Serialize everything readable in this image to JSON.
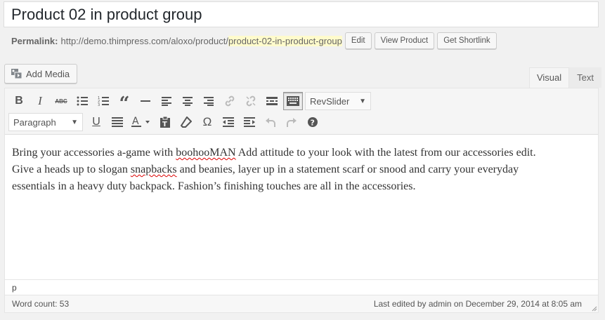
{
  "title": "Product 02 in product group",
  "permalink": {
    "label": "Permalink:",
    "base_url": "http://demo.thimpress.com/aloxo/product/",
    "slug": "product-02-in-product-group",
    "edit_label": "Edit",
    "view_label": "View Product",
    "shortlink_label": "Get Shortlink"
  },
  "add_media_label": "Add Media",
  "tabs": [
    {
      "label": "Visual",
      "active": true
    },
    {
      "label": "Text",
      "active": false
    }
  ],
  "toolbar": {
    "row1": [
      "bold",
      "italic",
      "strikethrough",
      "bullet-list",
      "numbered-list",
      "blockquote",
      "horizontal-line",
      "align-left",
      "align-center",
      "align-right",
      "insert-link",
      "remove-link",
      "read-more",
      "toolbar-toggle"
    ],
    "revslider_label": "RevSlider",
    "format_label": "Paragraph",
    "row2": [
      "underline",
      "justify",
      "text-color",
      "paste-as-text",
      "clear-formatting",
      "special-character",
      "outdent",
      "indent",
      "undo",
      "redo",
      "help"
    ]
  },
  "content": {
    "line1_before": "Bring your accessories a-game with ",
    "line1_spell": "boohooMAN",
    "line1_after": " Add attitude to your look with the latest from our accessories edit.",
    "line2_before": "Give a heads up to slogan ",
    "line2_spell": "snapbacks",
    "line2_after": " and beanies, layer up in a statement scarf or snood and carry your everyday",
    "line3": "essentials in a heavy duty backpack. Fashion’s finishing touches are all in the accessories."
  },
  "path": "p",
  "word_count": "Word count: 53",
  "last_edited": "Last edited by admin on December 29, 2014 at 8:05 am"
}
